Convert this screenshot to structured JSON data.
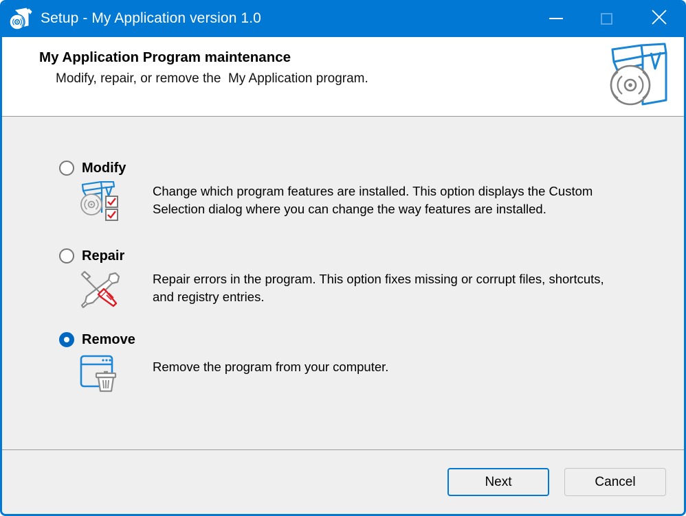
{
  "titlebar": {
    "title": "Setup - My Application version 1.0",
    "icon": "setup-box-disc-icon",
    "controls": {
      "minimize": "minimize-icon",
      "maximize": "maximize-icon",
      "close": "close-icon"
    }
  },
  "header": {
    "title": "My Application Program maintenance",
    "subtitle": "Modify, repair, or remove the  My Application program.",
    "logo": "package-box-disc-logo"
  },
  "options": [
    {
      "id": "modify",
      "label": "Modify",
      "selected": false,
      "icon": "modify-features-icon",
      "description": "Change which program features are installed. This option displays the Custom Selection dialog where you can change the way features are installed."
    },
    {
      "id": "repair",
      "label": "Repair",
      "selected": false,
      "icon": "wrench-screwdriver-icon",
      "description": "Repair errors in the program. This option fixes missing or corrupt files, shortcuts, and registry entries."
    },
    {
      "id": "remove",
      "label": "Remove",
      "selected": true,
      "icon": "window-trash-icon",
      "description": "Remove the program from your computer."
    }
  ],
  "footer": {
    "next_label": "Next",
    "cancel_label": "Cancel"
  },
  "colors": {
    "accent": "#0078d4",
    "radio_selected": "#0067c0",
    "body_bg": "#efefef",
    "header_bg": "#ffffff",
    "icon_blue": "#1b86d6",
    "icon_gray": "#808080",
    "icon_red": "#e01b24"
  }
}
